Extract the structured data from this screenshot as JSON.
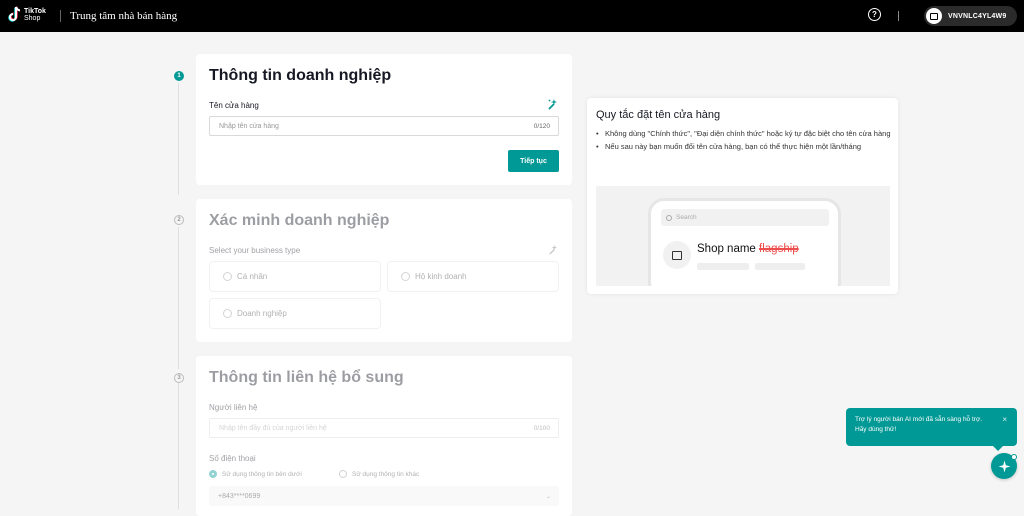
{
  "topbar": {
    "logo_line1": "TikTok",
    "logo_line2": "Shop",
    "title": "Trung tâm nhà bán hàng",
    "help_icon": "?",
    "account_name": "VNVNLC4YL4W9"
  },
  "steps": [
    "1",
    "2",
    "3"
  ],
  "section1": {
    "title": "Thông tin doanh nghiệp",
    "field_label": "Tên cửa hàng",
    "placeholder": "Nhập tên cửa hàng",
    "counter": "0/120",
    "button": "Tiếp tục"
  },
  "section2": {
    "title": "Xác minh doanh nghiệp",
    "field_label": "Select your business type",
    "options": [
      "Cá nhân",
      "Hộ kinh doanh",
      "Doanh nghiệp"
    ]
  },
  "section3": {
    "title": "Thông tin liên hệ bổ sung",
    "contact_label": "Người liên hệ",
    "contact_placeholder": "Nhập tên đầy đủ của người liên hệ",
    "contact_counter": "0/100",
    "phone_label": "Số điện thoại",
    "phone_option1": "Sử dụng thông tin bên dưới",
    "phone_option2": "Sử dụng thông tin khác",
    "phone_value": "+843****0699"
  },
  "rules": {
    "title": "Quy tắc đặt tên cửa hàng",
    "items": [
      "Không dùng \"Chính thức\", \"Đại diện chính thức\" hoặc ký tự đặc biệt cho tên cửa hàng",
      "Nếu sau này bạn muốn đổi tên cửa hàng, bạn có thể thực hiện một lần/tháng"
    ],
    "preview_search": "Search",
    "preview_shop": "Shop name",
    "preview_strike": "flagship"
  },
  "ai_assistant": {
    "message": "Trợ lý người bán AI mới đã sẵn sàng hỗ trợ. Hãy dùng thử!",
    "close": "×"
  },
  "colors": {
    "accent": "#009995",
    "topbar": "#000000",
    "strike": "#ee4d4d"
  }
}
